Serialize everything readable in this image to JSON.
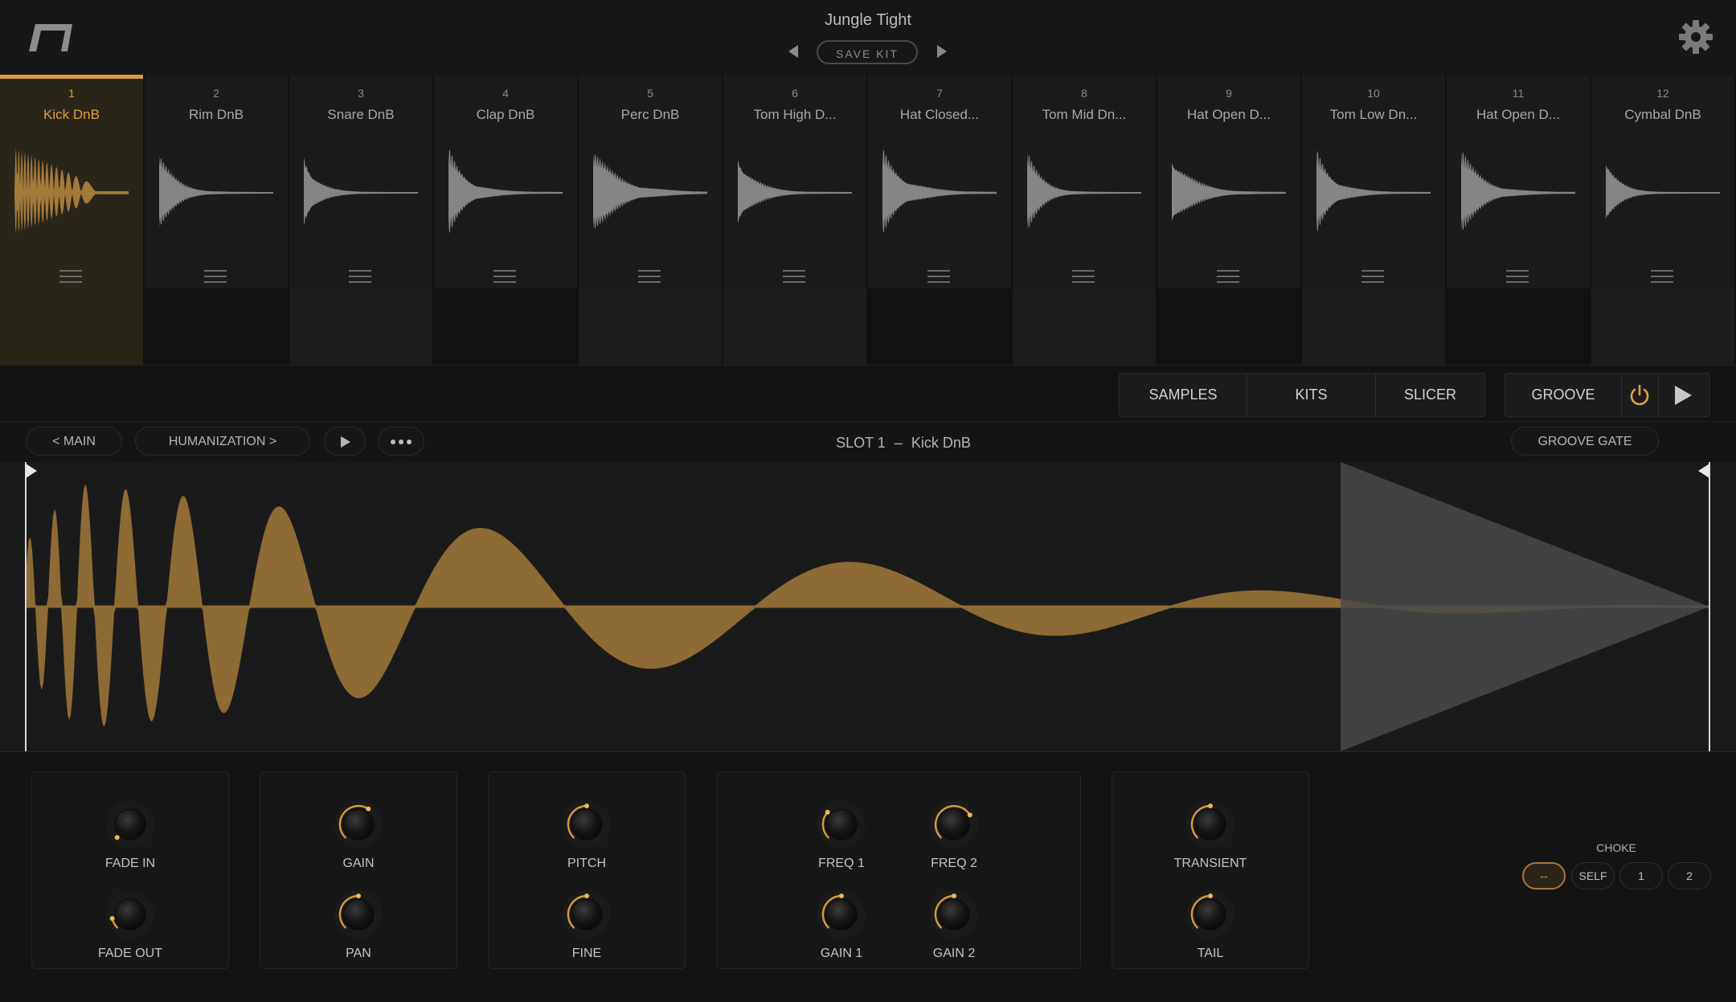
{
  "header": {
    "kit_name": "Jungle Tight",
    "save_kit": "SAVE KIT"
  },
  "colors": {
    "accent": "#d89c3a",
    "waveform": "#8e6a34",
    "background": "#121212"
  },
  "slots": [
    {
      "num": "1",
      "name": "Kick DnB",
      "active": true,
      "dark": false
    },
    {
      "num": "2",
      "name": "Rim DnB",
      "active": false,
      "dark": true
    },
    {
      "num": "3",
      "name": "Snare DnB",
      "active": false,
      "dark": false
    },
    {
      "num": "4",
      "name": "Clap DnB",
      "active": false,
      "dark": true
    },
    {
      "num": "5",
      "name": "Perc DnB",
      "active": false,
      "dark": false
    },
    {
      "num": "6",
      "name": "Tom High D...",
      "active": false,
      "dark": false
    },
    {
      "num": "7",
      "name": "Hat Closed...",
      "active": false,
      "dark": true
    },
    {
      "num": "8",
      "name": "Tom Mid Dn...",
      "active": false,
      "dark": false
    },
    {
      "num": "9",
      "name": "Hat Open D...",
      "active": false,
      "dark": true
    },
    {
      "num": "10",
      "name": "Tom Low Dn...",
      "active": false,
      "dark": false
    },
    {
      "num": "11",
      "name": "Hat Open D...",
      "active": false,
      "dark": true
    },
    {
      "num": "12",
      "name": "Cymbal DnB",
      "active": false,
      "dark": false
    }
  ],
  "modes": {
    "samples": "SAMPLES",
    "kits": "KITS",
    "slicer": "SLICER",
    "groove": "GROOVE"
  },
  "subbar": {
    "main": "< MAIN",
    "humanization": "HUMANIZATION >",
    "slot_prefix": "SLOT 1",
    "slot_sep": "–",
    "slot_name": "Kick DnB",
    "groove_gate": "GROOVE GATE"
  },
  "knobs": {
    "fade_in": "FADE IN",
    "fade_out": "FADE OUT",
    "gain": "GAIN",
    "pan": "PAN",
    "pitch": "PITCH",
    "fine": "FINE",
    "freq1": "FREQ 1",
    "freq2": "FREQ 2",
    "gain1": "GAIN 1",
    "gain2": "GAIN 2",
    "transient": "TRANSIENT",
    "tail": "TAIL"
  },
  "choke": {
    "label": "CHOKE",
    "options": [
      "--",
      "SELF",
      "1",
      "2"
    ],
    "selected": "--"
  }
}
